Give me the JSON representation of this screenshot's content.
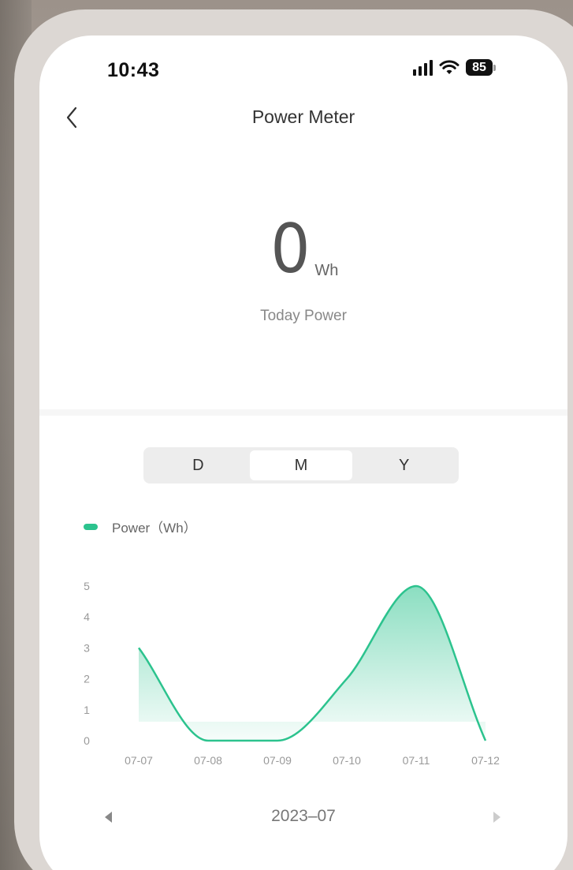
{
  "status_bar": {
    "time": "10:43",
    "battery": "85"
  },
  "nav": {
    "title": "Power Meter",
    "back_icon": "chevron-left-icon"
  },
  "today": {
    "value": "0",
    "unit": "Wh",
    "label": "Today Power"
  },
  "period_tabs": [
    {
      "label": "D",
      "active": false
    },
    {
      "label": "M",
      "active": true
    },
    {
      "label": "Y",
      "active": false
    }
  ],
  "colors": {
    "accent": "#2cc38e"
  },
  "chart_data": {
    "type": "area",
    "legend": "Power（Wh）",
    "categories": [
      "07-07",
      "07-08",
      "07-09",
      "07-10",
      "07-11",
      "07-12"
    ],
    "series": [
      {
        "name": "Power（Wh）",
        "values": [
          3,
          0,
          0,
          2,
          5,
          0
        ]
      }
    ],
    "yticks": [
      "0",
      "1",
      "2",
      "3",
      "4",
      "5"
    ],
    "ylim": [
      0,
      5
    ],
    "grid": false,
    "legend_position": "top-left"
  },
  "month_nav": {
    "label": "2023–07",
    "prev_icon": "triangle-left-icon",
    "next_icon": "triangle-right-icon"
  }
}
